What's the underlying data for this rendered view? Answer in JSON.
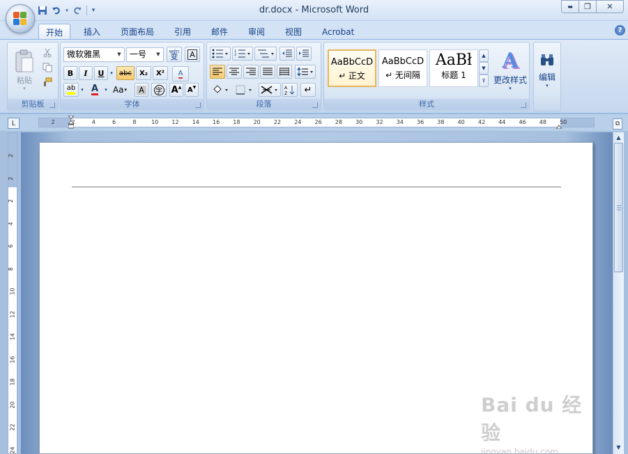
{
  "window": {
    "title": "dr.docx - Microsoft Word",
    "min_glyph": "▬",
    "max_glyph": "❐",
    "close_glyph": "✕"
  },
  "qat": {
    "save_icon": "save-icon",
    "undo_icon": "undo-icon",
    "redo_icon": "redo-icon",
    "customize_icon": "dropdown-icon"
  },
  "tabs": [
    {
      "label": "开始",
      "active": true
    },
    {
      "label": "插入"
    },
    {
      "label": "页面布局"
    },
    {
      "label": "引用"
    },
    {
      "label": "邮件"
    },
    {
      "label": "审阅"
    },
    {
      "label": "视图"
    },
    {
      "label": "Acrobat"
    }
  ],
  "help_glyph": "?",
  "groups": {
    "clipboard": {
      "label": "剪贴板",
      "paste": "粘贴"
    },
    "font": {
      "label": "字体",
      "font_name": "微软雅黑",
      "font_size": "一号",
      "wen": "wén",
      "wen_char": "变",
      "border_char": "A",
      "bold": "B",
      "italic": "I",
      "underline": "U",
      "strike": "abc",
      "subscript": "X₂",
      "superscript": "X²",
      "clear": "A",
      "highlight": "ab",
      "color": "A",
      "case": "Aa",
      "shade": "A",
      "enclose": "字",
      "grow": "A",
      "shrink": "A"
    },
    "paragraph": {
      "label": "段落"
    },
    "styles": {
      "label": "样式",
      "items": [
        {
          "sample": "AaBbCcD",
          "name": "↵ 正文"
        },
        {
          "sample": "AaBbCcD",
          "name": "↵ 无间隔"
        },
        {
          "sample": "AaBł",
          "name": "标题 1"
        }
      ],
      "change": "更改样式",
      "change_icon": "A"
    },
    "edit": {
      "label": "编辑",
      "icon": "find-binoculars-icon"
    }
  },
  "ruler": {
    "corner": "L",
    "numbers": [
      "2",
      "2",
      "4",
      "6",
      "8",
      "10",
      "12",
      "14",
      "16",
      "18",
      "20",
      "22",
      "24",
      "26",
      "28",
      "30",
      "32",
      "34",
      "36",
      "38",
      "40",
      "42",
      "44",
      "46",
      "48",
      "50"
    ],
    "vnumbers": [
      "2",
      "2",
      "2",
      "4",
      "6",
      "8",
      "10",
      "12",
      "14",
      "16",
      "18",
      "20",
      "22",
      "24"
    ]
  },
  "watermark": {
    "logo": "Bai du 经验",
    "url": "jingyan.baidu.com"
  },
  "colors": {
    "accent": "#15428b",
    "ribbon_bg": "#dfe9f6",
    "highlight_yellow": "#ffff00",
    "font_red": "#e02020"
  }
}
